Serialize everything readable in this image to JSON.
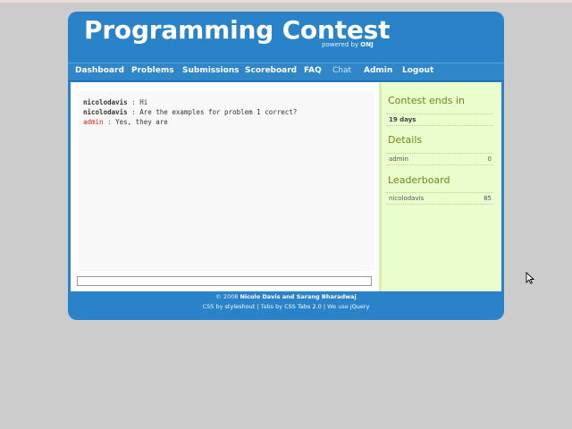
{
  "header": {
    "title": "Programming Contest",
    "powered_prefix": "powered by",
    "powered_brand": "ONJ"
  },
  "nav": {
    "items": [
      {
        "label": "Dashboard"
      },
      {
        "label": "Problems"
      },
      {
        "label": "Submissions"
      },
      {
        "label": "Scoreboard"
      },
      {
        "label": "FAQ"
      },
      {
        "label": "Chat"
      },
      {
        "label": "Admin"
      },
      {
        "label": "Logout"
      }
    ],
    "active": "Chat"
  },
  "chat": {
    "messages": [
      {
        "user": "nicolodavis",
        "sep": ":",
        "text": "Hi"
      },
      {
        "user": "nicolodavis",
        "sep": ":",
        "text": "Are the examples for problem 1 correct?"
      },
      {
        "user": "admin",
        "sep": ":",
        "text": "Yes, they are"
      }
    ],
    "input_value": ""
  },
  "sidebar": {
    "contest_heading": "Contest ends in",
    "contest_remaining": "19 days",
    "details_heading": "Details",
    "details_row": {
      "label": "admin",
      "value": "0"
    },
    "leaderboard_heading": "Leaderboard",
    "leaderboard_row": {
      "label": "nicolodavis",
      "value": "85"
    }
  },
  "footer": {
    "copyright_prefix": "© 2008",
    "authors": "Nicolo Davis and Sarang Bharadwaj",
    "line2": {
      "css_by": "CSS by",
      "css_author": "styleshout",
      "tabs_by": "| Tabs by",
      "tabs_author": "CSS Tabs 2.0",
      "we_use": "| We use",
      "lib": "jQuery"
    }
  },
  "colors": {
    "brand": "#2a83c8",
    "sidebar_bg": "#eafdcc",
    "sidebar_heading": "#6b8a16",
    "admin_text": "#cc2222"
  }
}
